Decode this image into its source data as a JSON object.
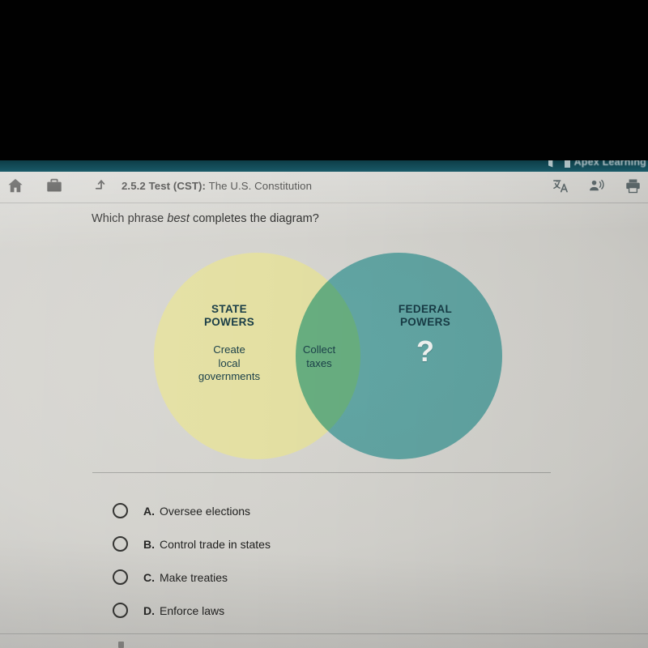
{
  "brand": {
    "name": "Apex Learning",
    "logo_icon": "apex-logo-icon",
    "strip_color": "#15505d"
  },
  "toolbar": {
    "home_icon": "home-icon",
    "briefcase_icon": "briefcase-icon",
    "return_icon": "return-arrow-icon",
    "title_bold": "2.5.2  Test (CST):",
    "title_regular": "The U.S. Constitution",
    "translate_icon": "translate-icon",
    "read_aloud_icon": "read-aloud-icon",
    "print_icon": "print-icon"
  },
  "question": {
    "before": "Which phrase ",
    "emphasis": "best",
    "after": " completes the diagram?"
  },
  "chart_data": {
    "type": "venn",
    "title": "State Powers and Federal Powers Venn diagram",
    "sets": [
      {
        "name": "STATE POWERS",
        "side": "left",
        "color": "#e4e0a3",
        "items": [
          "Create local governments"
        ]
      },
      {
        "name": "FEDERAL POWERS",
        "side": "right",
        "color": "#74c6c8",
        "items": [
          "?"
        ]
      }
    ],
    "intersection": {
      "color": "#7cc08a",
      "items": [
        "Collect taxes"
      ]
    },
    "missing_marker": "?",
    "text_color": "#173b45"
  },
  "venn": {
    "left_label": "STATE\nPOWERS",
    "left_label_line1": "STATE",
    "left_label_line2": "POWERS",
    "left_body": "Create\nlocal\ngovernments",
    "left_body_line1": "Create",
    "left_body_line2": "local",
    "left_body_line3": "governments",
    "middle_line1": "Collect",
    "middle_line2": "taxes",
    "right_label_line1": "FEDERAL",
    "right_label_line2": "POWERS",
    "right_question_mark": "?"
  },
  "answers": [
    {
      "letter": "A.",
      "text": "Oversee elections",
      "selected": false
    },
    {
      "letter": "B.",
      "text": "Control trade in states",
      "selected": false
    },
    {
      "letter": "C.",
      "text": "Make treaties",
      "selected": false
    },
    {
      "letter": "D.",
      "text": "Enforce laws",
      "selected": false
    }
  ]
}
